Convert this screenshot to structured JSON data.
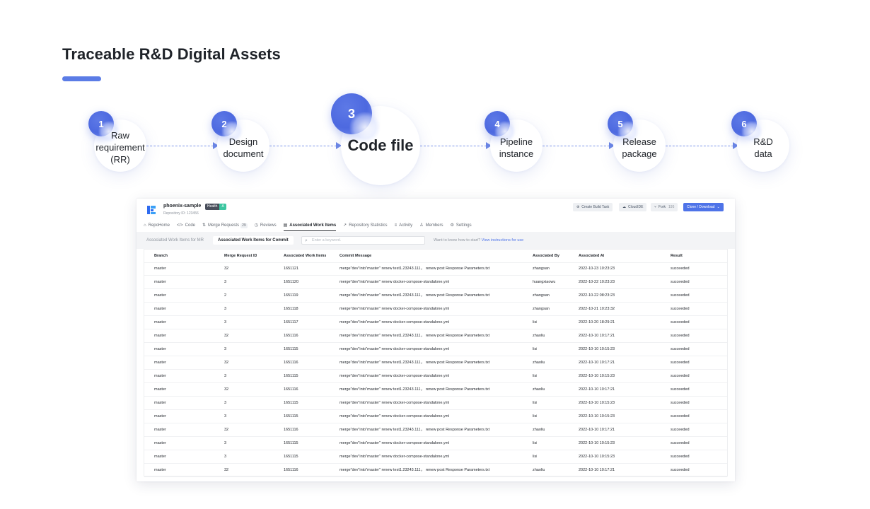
{
  "headline": "Traceable R&D Digital Assets",
  "colors": {
    "accent": "#5b7ce6",
    "primary_button": "#4e73e8",
    "health_ok": "#3cc6a0"
  },
  "flow_steps": [
    {
      "num": "1",
      "lines": [
        "Raw",
        "requirement",
        "(RR)"
      ]
    },
    {
      "num": "2",
      "lines": [
        "Design",
        "document"
      ]
    },
    {
      "num": "3",
      "lines": [
        "Code file"
      ]
    },
    {
      "num": "4",
      "lines": [
        "Pipeline",
        "instance"
      ]
    },
    {
      "num": "5",
      "lines": [
        "Release",
        "package"
      ]
    },
    {
      "num": "6",
      "lines": [
        "R&D",
        "data"
      ]
    }
  ],
  "repo": {
    "name": "phoenix-sample",
    "health_label": "Health",
    "health_value": "A",
    "repo_id": "Repository ID: 123456",
    "actions": {
      "create_build": "Create Build Task",
      "cloudide": "CloudIDE",
      "fork": "Fork",
      "fork_count": "195",
      "clone": "Clone / Download"
    },
    "icons": {
      "create_build": "plus-circle-icon",
      "cloudide": "cloud-icon",
      "fork": "fork-icon",
      "clone": "chevron-down-icon"
    }
  },
  "tabs": [
    {
      "label": "RepoHome",
      "icon": "home-icon",
      "glyph": "⌂"
    },
    {
      "label": "Code",
      "icon": "code-icon",
      "glyph": "</>"
    },
    {
      "label": "Merge Requests",
      "icon": "merge-icon",
      "glyph": "⇅",
      "badge": "29"
    },
    {
      "label": "Reviews",
      "icon": "review-icon",
      "glyph": "◷"
    },
    {
      "label": "Associated Work Items",
      "icon": "document-icon",
      "glyph": "▤",
      "active": true
    },
    {
      "label": "Repository Statistics",
      "icon": "chart-icon",
      "glyph": "↗"
    },
    {
      "label": "Activity",
      "icon": "list-icon",
      "glyph": "≡"
    },
    {
      "label": "Members",
      "icon": "user-icon",
      "glyph": "♙"
    },
    {
      "label": "Settings",
      "icon": "gear-icon",
      "glyph": "⚙"
    }
  ],
  "subbar": {
    "seg_mr": "Associated Work Items for MR",
    "seg_commit": "Associated Work Items for Commit",
    "search_placeholder": "Enter a keyword.",
    "hint_text": "Want to know how to start?",
    "hint_link": "View instructions for use"
  },
  "table": {
    "columns": [
      "Branch",
      "Merge Request ID",
      "Associated Work Items",
      "Commit Message",
      "Associated By",
      "Associated At",
      "Result"
    ],
    "rows": [
      [
        "master",
        "32",
        "1651121",
        "merge\"dev\"into\"master\" renew test1.23243.111， renew post Response Parameters.txt",
        "zhangsan",
        "2022-10-23 10:23:23",
        "succeeded"
      ],
      [
        "master",
        "3",
        "1651120",
        "merge\"dev\"into\"master\" renew docker-compose-standalone.yml",
        "huangxiaowu",
        "2022-10-22 10:23:23",
        "succeeded"
      ],
      [
        "master",
        "2",
        "1651119",
        "merge\"dev\"into\"master\" renew test1.23243.111， renew post Response Parameters.txt",
        "zhangsan",
        "2022-10-22 08:23:23",
        "succeeded"
      ],
      [
        "master",
        "3",
        "1651118",
        "merge\"dev\"into\"master\" renew docker-compose-standalone.yml",
        "zhangsan",
        "2022-10-21 10:23:32",
        "succeeded"
      ],
      [
        "master",
        "3",
        "1651117",
        "merge\"dev\"into\"master\" renew docker-compose-standalone.yml",
        "lisi",
        "2022-10-20 18:29:21",
        "succeeded"
      ],
      [
        "master",
        "32",
        "1651116",
        "merge\"dev\"into\"master\" renew test1.23243.111， renew post Response Parameters.txt",
        "zhaoliu",
        "2022-10-10 10:17:21",
        "succeeded"
      ],
      [
        "master",
        "3",
        "1651115",
        "merge\"dev\"into\"master\" renew docker-compose-standalone.yml",
        "lisi",
        "2022-10-10 10:15:23",
        "succeeded"
      ],
      [
        "master",
        "32",
        "1651116",
        "merge\"dev\"into\"master\" renew test1.23243.111， renew post Response Parameters.txt",
        "zhaoliu",
        "2022-10-10 10:17:21",
        "succeeded"
      ],
      [
        "master",
        "3",
        "1651115",
        "merge\"dev\"into\"master\" renew docker-compose-standalone.yml",
        "lisi",
        "2022-10-10 10:15:23",
        "succeeded"
      ],
      [
        "master",
        "32",
        "1651116",
        "merge\"dev\"into\"master\" renew test1.23243.111， renew post Response Parameters.txt",
        "zhaoliu",
        "2022-10-10 10:17:21",
        "succeeded"
      ],
      [
        "master",
        "3",
        "1651115",
        "merge\"dev\"into\"master\" renew docker-compose-standalone.yml",
        "lisi",
        "2022-10-10 10:15:23",
        "succeeded"
      ],
      [
        "master",
        "3",
        "1651115",
        "merge\"dev\"into\"master\" renew docker-compose-standalone.yml",
        "lisi",
        "2022-10-10 10:15:23",
        "succeeded"
      ],
      [
        "master",
        "32",
        "1651116",
        "merge\"dev\"into\"master\" renew test1.23243.111， renew post Response Parameters.txt",
        "zhaoliu",
        "2022-10-10 10:17:21",
        "succeeded"
      ],
      [
        "master",
        "3",
        "1651115",
        "merge\"dev\"into\"master\" renew docker-compose-standalone.yml",
        "lisi",
        "2022-10-10 10:15:23",
        "succeeded"
      ],
      [
        "master",
        "3",
        "1651115",
        "merge\"dev\"into\"master\" renew docker-compose-standalone.yml",
        "lisi",
        "2022-10-10 10:15:23",
        "succeeded"
      ],
      [
        "master",
        "32",
        "1651116",
        "merge\"dev\"into\"master\" renew test1.23243.111， renew post Response Parameters.txt",
        "zhaoliu",
        "2022-10-10 10:17:21",
        "succeeded"
      ]
    ]
  }
}
